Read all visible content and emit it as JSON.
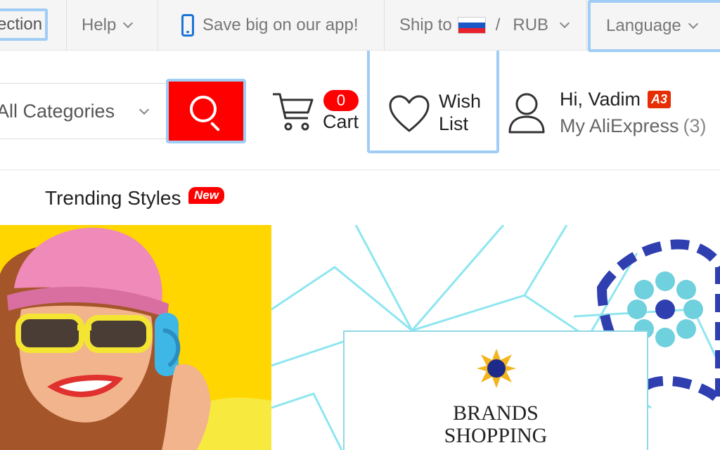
{
  "topbar": {
    "collection_label": "ection",
    "help_label": "Help",
    "app_promo": "Save big on our app!",
    "ship_to_label": "Ship to",
    "currency_sep": "/",
    "currency": "RUB",
    "language_label": "Language",
    "flag_colors": [
      "#ffffff",
      "#1c57c7",
      "#e8212c"
    ]
  },
  "header": {
    "category_select": "All Categories",
    "cart_count": "0",
    "cart_label": "Cart",
    "wish_line1": "Wish",
    "wish_line2": "List",
    "greeting": "Hi, Vadim",
    "member_badge": "A3",
    "account_link": "My AliExpress",
    "account_count": "(3)"
  },
  "nav": {
    "trending_label": "Trending Styles",
    "new_badge": "New"
  },
  "banners": {
    "brand_line1": "BRANDS",
    "brand_line2": "SHOPPING"
  },
  "colors": {
    "accent_red": "#ff0000",
    "focus_ring": "#9fcdf6",
    "topbar_bg": "#f5f5f5",
    "banner_yellow": "#ffd600"
  }
}
